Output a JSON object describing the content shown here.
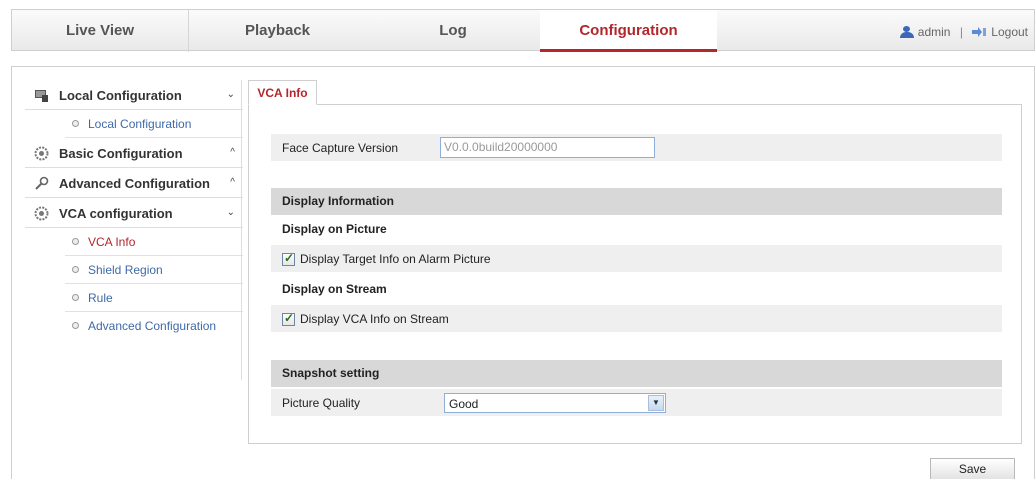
{
  "nav": {
    "tabs": [
      {
        "label": "Live View"
      },
      {
        "label": "Playback"
      },
      {
        "label": "Log"
      },
      {
        "label": "Configuration"
      }
    ],
    "active_tab": "Configuration",
    "user": "admin",
    "separator": "|",
    "logout": "Logout"
  },
  "sidebar": {
    "local": {
      "title": "Local Configuration",
      "items": [
        {
          "label": "Local Configuration"
        }
      ]
    },
    "basic": {
      "title": "Basic Configuration"
    },
    "advanced": {
      "title": "Advanced Configuration"
    },
    "vca": {
      "title": "VCA configuration",
      "items": [
        {
          "label": "VCA Info"
        },
        {
          "label": "Shield Region"
        },
        {
          "label": "Rule"
        },
        {
          "label": "Advanced Configuration"
        }
      ]
    }
  },
  "content": {
    "tab_label": "VCA Info",
    "face_capture_label": "Face Capture Version",
    "face_capture_value": "V0.0.0build20000000",
    "display_info_header": "Display Information",
    "display_on_picture": "Display on Picture",
    "chk_alarm_picture": "Display Target Info on Alarm Picture",
    "display_on_stream": "Display on Stream",
    "chk_vca_stream": "Display VCA Info on Stream",
    "snapshot_header": "Snapshot setting",
    "picture_quality_label": "Picture Quality",
    "picture_quality_value": "Good",
    "save_label": "Save"
  },
  "colors": {
    "accent": "#b2272c",
    "link": "#3f6aa8"
  }
}
